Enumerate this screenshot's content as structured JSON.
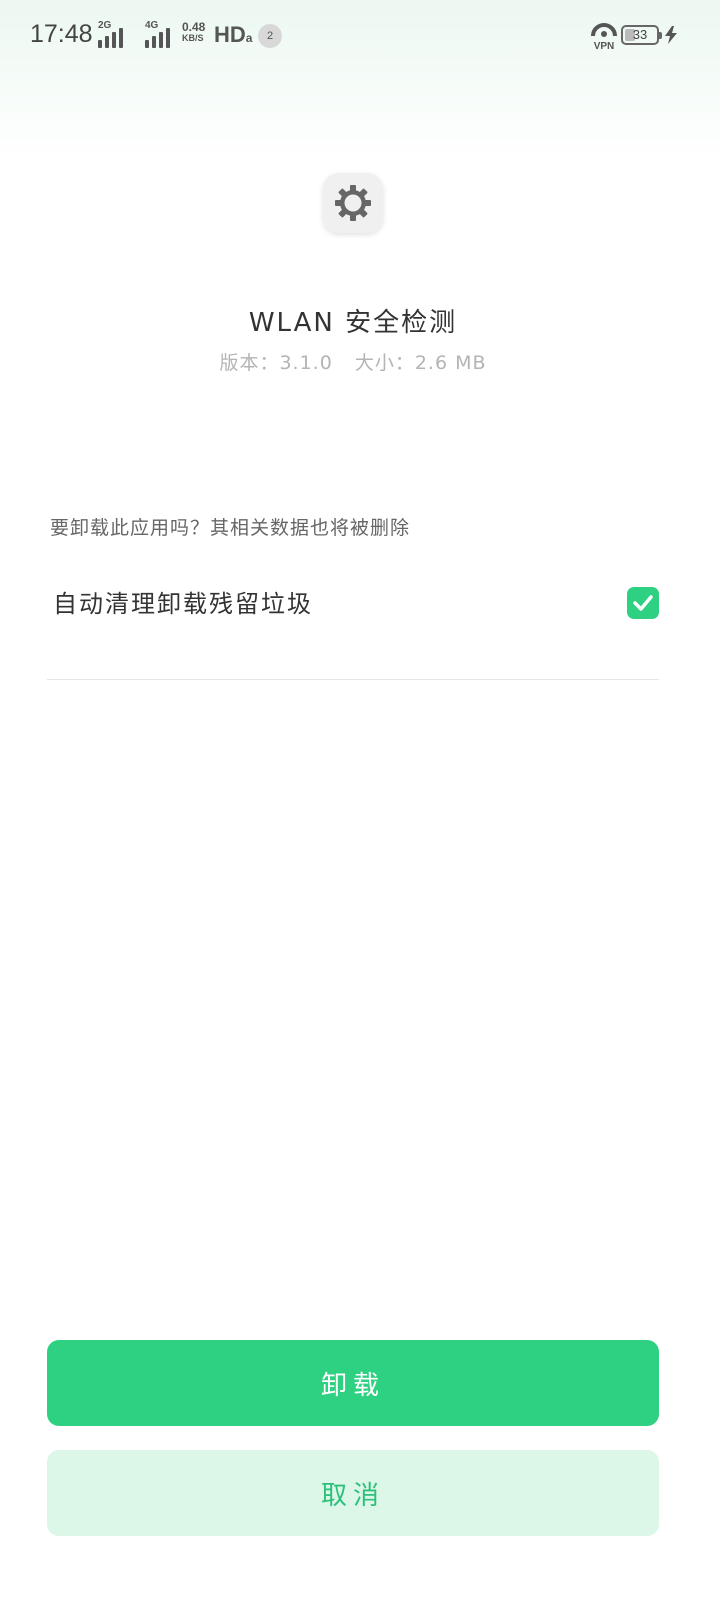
{
  "status_bar": {
    "time": "17:48",
    "sim1_network": "2G",
    "sim2_network": "4G",
    "speed_value": "0.48",
    "speed_unit": "KB/S",
    "hd_label": "HD",
    "notification_count": "2",
    "vpn_label": "VPN",
    "battery_level": "33"
  },
  "app": {
    "icon": "gear-icon",
    "name": "WLAN 安全检测",
    "version": "版本：3.1.0",
    "size": "大小：2.6 MB"
  },
  "dialog": {
    "question": "要卸载此应用吗？其相关数据也将被删除",
    "option_label": "自动清理卸载残留垃圾",
    "option_checked": true
  },
  "buttons": {
    "uninstall_label": "卸载",
    "cancel_label": "取消"
  },
  "colors": {
    "accent": "#2ed082",
    "cancel_bg": "#dcf6e8",
    "cancel_text": "#2ec07a"
  }
}
